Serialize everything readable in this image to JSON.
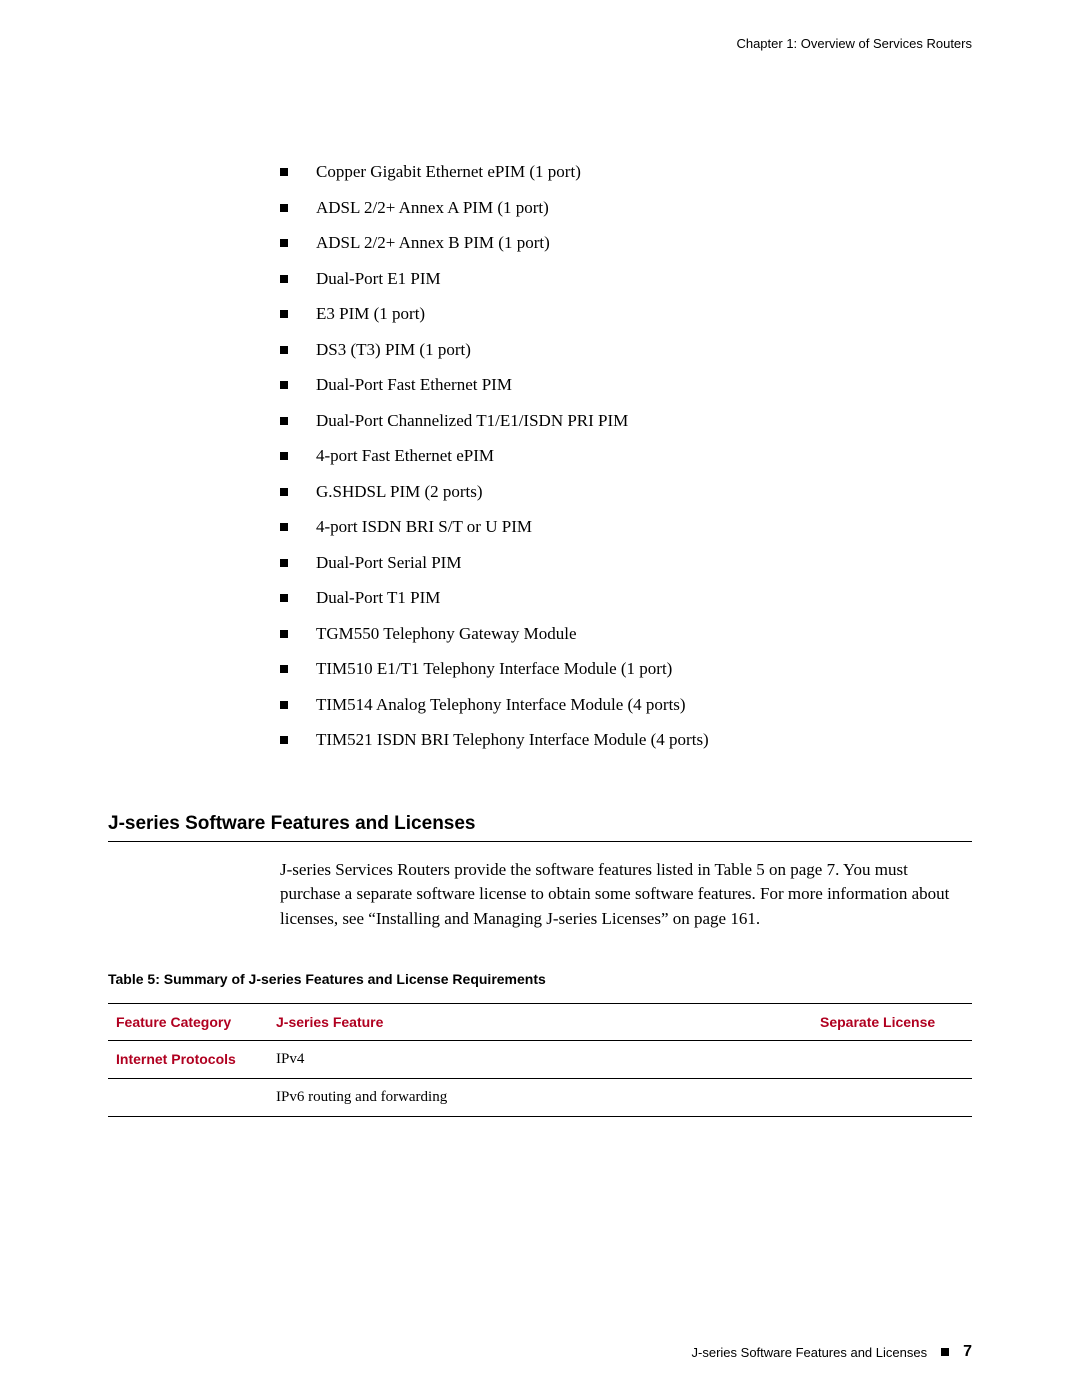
{
  "header": {
    "chapter": "Chapter 1: Overview of Services Routers"
  },
  "bullets": [
    "Copper Gigabit Ethernet ePIM (1 port)",
    "ADSL 2/2+ Annex A PIM (1 port)",
    "ADSL 2/2+ Annex B PIM (1 port)",
    "Dual-Port E1 PIM",
    "E3 PIM (1 port)",
    "DS3 (T3) PIM (1 port)",
    "Dual-Port Fast Ethernet PIM",
    "Dual-Port Channelized T1/E1/ISDN PRI PIM",
    "4-port Fast Ethernet ePIM",
    "G.SHDSL PIM (2 ports)",
    "4-port ISDN BRI S/T or U PIM",
    "Dual-Port Serial PIM",
    "Dual-Port T1 PIM",
    "TGM550 Telephony Gateway Module",
    "TIM510 E1/T1 Telephony Interface Module (1 port)",
    "TIM514 Analog Telephony Interface Module (4 ports)",
    "TIM521 ISDN BRI Telephony Interface Module (4 ports)"
  ],
  "section": {
    "heading": "J-series Software Features and Licenses",
    "paragraph": "J-series Services Routers provide the software features listed in Table 5 on page 7. You must purchase a separate software license to obtain some software features. For more information about licenses, see “Installing and Managing J-series Licenses” on page 161."
  },
  "table": {
    "caption": "Table 5: Summary of J-series Features and License Requirements",
    "headers": {
      "category": "Feature Category",
      "feature": "J-series Feature",
      "license": "Separate License"
    },
    "rows": [
      {
        "category": "Internet Protocols",
        "feature": "IPv4",
        "license": ""
      },
      {
        "category": "",
        "feature": "IPv6 routing and forwarding",
        "license": ""
      }
    ]
  },
  "footer": {
    "section": "J-series Software Features and Licenses",
    "page": "7"
  }
}
